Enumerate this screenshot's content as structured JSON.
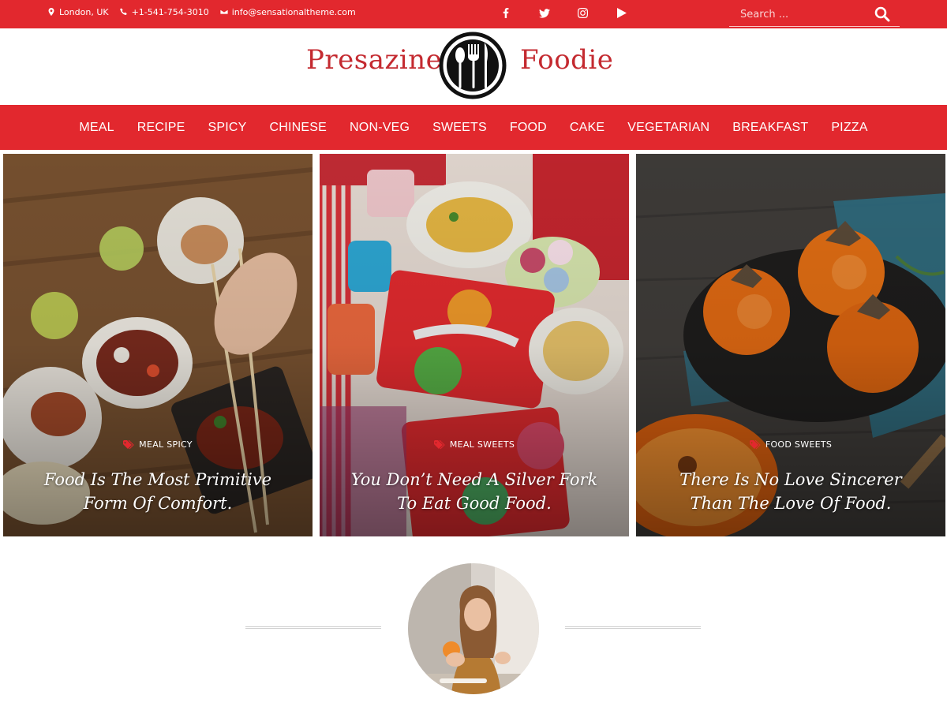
{
  "topbar": {
    "location": "London, UK",
    "phone": "+1-541-754-3010",
    "email": "info@sensationaltheme.com",
    "social": [
      "facebook-icon",
      "twitter-icon",
      "instagram-icon",
      "youtube-icon"
    ],
    "search_placeholder": "Search ..."
  },
  "brand": {
    "word1": "Presazine",
    "word2": "Foodie"
  },
  "nav": {
    "items": [
      "MEAL",
      "RECIPE",
      "SPICY",
      "CHINESE",
      "NON-VEG",
      "SWEETS",
      "FOOD",
      "CAKE",
      "VEGETARIAN",
      "BREAKFAST",
      "PIZZA"
    ]
  },
  "cards": [
    {
      "categories": "MEAL SPICY",
      "title": "Food Is The Most Primitive Form Of Comfort."
    },
    {
      "categories": "MEAL SWEETS",
      "title": "You Don’t Need A Silver Fork To Eat Good Food."
    },
    {
      "categories": "FOOD SWEETS",
      "title": "There Is No Love Sincerer Than The Love Of Food."
    }
  ],
  "colors": {
    "accent": "#e2282e",
    "logo": "#c42a30"
  }
}
